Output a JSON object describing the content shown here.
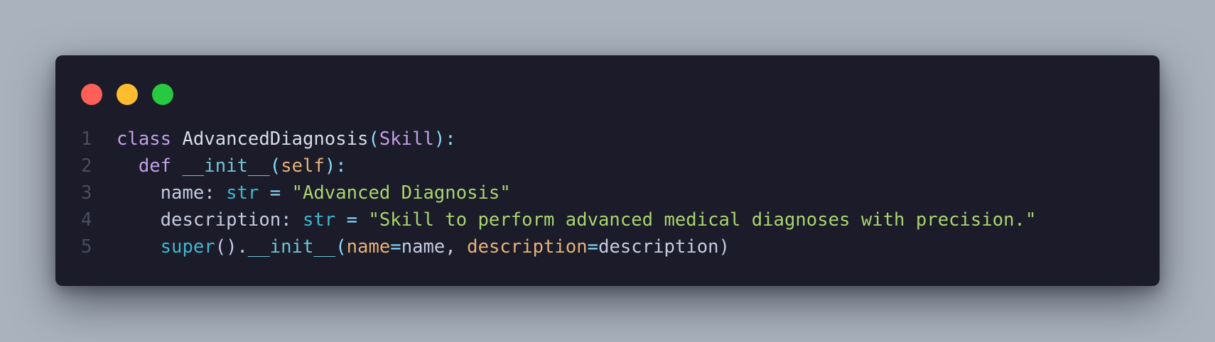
{
  "window": {
    "controls": {
      "close": "close",
      "minimize": "minimize",
      "zoom": "zoom"
    }
  },
  "code": {
    "lines": [
      {
        "number": "1",
        "tokens": [
          {
            "text": "class",
            "kind": "keyword"
          },
          {
            "text": " ",
            "kind": "space"
          },
          {
            "text": "AdvancedDiagnosis",
            "kind": "class-name"
          },
          {
            "text": "(",
            "kind": "punctuation"
          },
          {
            "text": "Skill",
            "kind": "keyword"
          },
          {
            "text": "):",
            "kind": "punctuation"
          }
        ]
      },
      {
        "number": "2",
        "tokens": [
          {
            "text": "  ",
            "kind": "space"
          },
          {
            "text": "def",
            "kind": "keyword"
          },
          {
            "text": " ",
            "kind": "space"
          },
          {
            "text": "__init__",
            "kind": "function"
          },
          {
            "text": "(",
            "kind": "punctuation"
          },
          {
            "text": "self",
            "kind": "self"
          },
          {
            "text": "):",
            "kind": "punctuation"
          }
        ]
      },
      {
        "number": "3",
        "tokens": [
          {
            "text": "    ",
            "kind": "space"
          },
          {
            "text": "name",
            "kind": "plain"
          },
          {
            "text": ": ",
            "kind": "plain"
          },
          {
            "text": "str",
            "kind": "type"
          },
          {
            "text": " = ",
            "kind": "operator"
          },
          {
            "text": "\"Advanced Diagnosis\"",
            "kind": "string"
          }
        ]
      },
      {
        "number": "4",
        "tokens": [
          {
            "text": "    ",
            "kind": "space"
          },
          {
            "text": "description",
            "kind": "plain"
          },
          {
            "text": ": ",
            "kind": "plain"
          },
          {
            "text": "str",
            "kind": "type"
          },
          {
            "text": " = ",
            "kind": "operator"
          },
          {
            "text": "\"Skill to perform advanced medical diagnoses with precision.\"",
            "kind": "string"
          }
        ]
      },
      {
        "number": "5",
        "tokens": [
          {
            "text": "    ",
            "kind": "space"
          },
          {
            "text": "super",
            "kind": "function"
          },
          {
            "text": "().",
            "kind": "punctuation"
          },
          {
            "text": "__init__",
            "kind": "function"
          },
          {
            "text": "(",
            "kind": "punctuation"
          },
          {
            "text": "name",
            "kind": "parameter"
          },
          {
            "text": "=",
            "kind": "operator"
          },
          {
            "text": "name",
            "kind": "plain"
          },
          {
            "text": ", ",
            "kind": "plain"
          },
          {
            "text": "description",
            "kind": "parameter"
          },
          {
            "text": "=",
            "kind": "operator"
          },
          {
            "text": "description",
            "kind": "plain"
          },
          {
            "text": ")",
            "kind": "punctuation"
          }
        ]
      }
    ]
  },
  "colors": {
    "page_background": "#a9b2bd",
    "window_background": "#1b1b29",
    "close": "#ff5f57",
    "minimize": "#febc2e",
    "zoom": "#28c840",
    "keyword": "#c39ee8",
    "string": "#a9d46f",
    "type": "#3fb7cf",
    "parameter": "#e5b27a",
    "line_number": "#4a4d60"
  }
}
